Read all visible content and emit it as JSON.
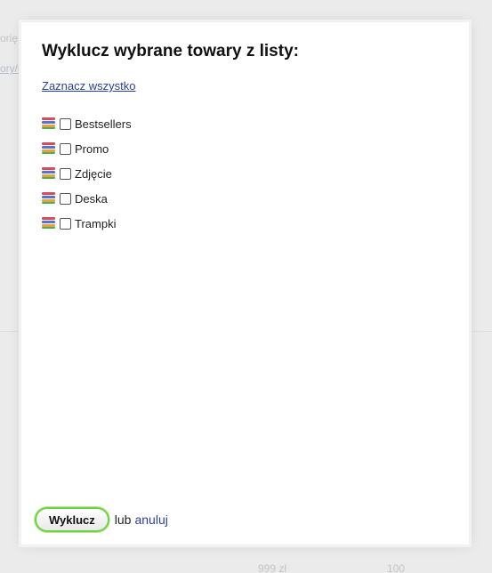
{
  "background": {
    "snippet_1": "orię",
    "snippet_2": "ory/s",
    "snippet_3": "999 zł",
    "snippet_4": "100"
  },
  "modal": {
    "title": "Wyklucz wybrane towary z listy:",
    "select_all_label": "Zaznacz wszystko",
    "items": [
      {
        "label": "Bestsellers",
        "checked": false
      },
      {
        "label": "Promo",
        "checked": false
      },
      {
        "label": "Zdjęcie",
        "checked": false
      },
      {
        "label": "Deska",
        "checked": false
      },
      {
        "label": "Trampki",
        "checked": false
      }
    ],
    "submit_label": "Wyklucz",
    "or_text": "lub",
    "cancel_label": "anuluj"
  },
  "colors": {
    "link": "#2b3f9c",
    "button_border": "#6fd23d"
  }
}
